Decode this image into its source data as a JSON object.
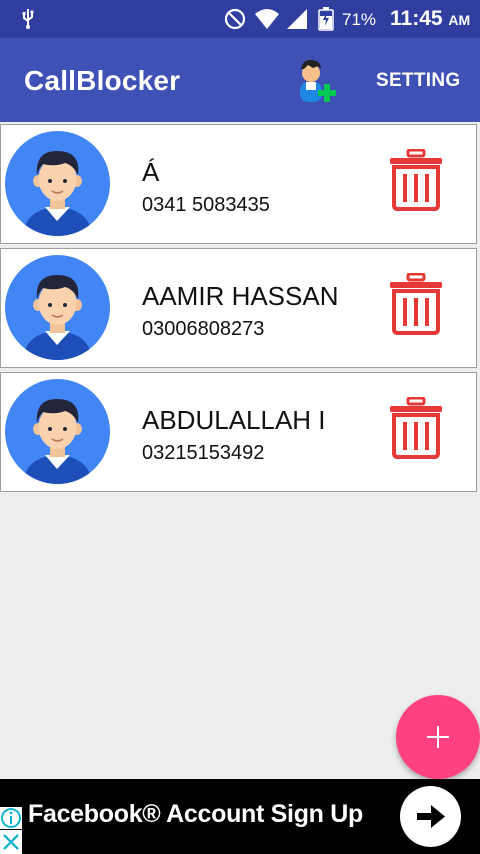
{
  "status_bar": {
    "battery_percent": "71%",
    "time": "11:45",
    "ampm": "AM"
  },
  "app_bar": {
    "title": "CallBlocker",
    "setting_label": "SETTING",
    "add_user_icon": "add-user-icon"
  },
  "contacts": [
    {
      "name": "Á",
      "phone": "0341 5083435"
    },
    {
      "name": "AAMIR HASSAN",
      "phone": "03006808273"
    },
    {
      "name": "ABDULALLAH I",
      "phone": "03215153492"
    }
  ],
  "fab": {
    "icon": "plus-icon",
    "color": "#ff4081"
  },
  "ad": {
    "text": "Facebook® Account Sign Up",
    "button_icon": "arrow-right-icon"
  },
  "colors": {
    "primary": "#3f51b5",
    "primary_dark": "#303f9f",
    "accent": "#ff4081",
    "trash": "#e53935",
    "avatar_bg": "#4285f4"
  }
}
